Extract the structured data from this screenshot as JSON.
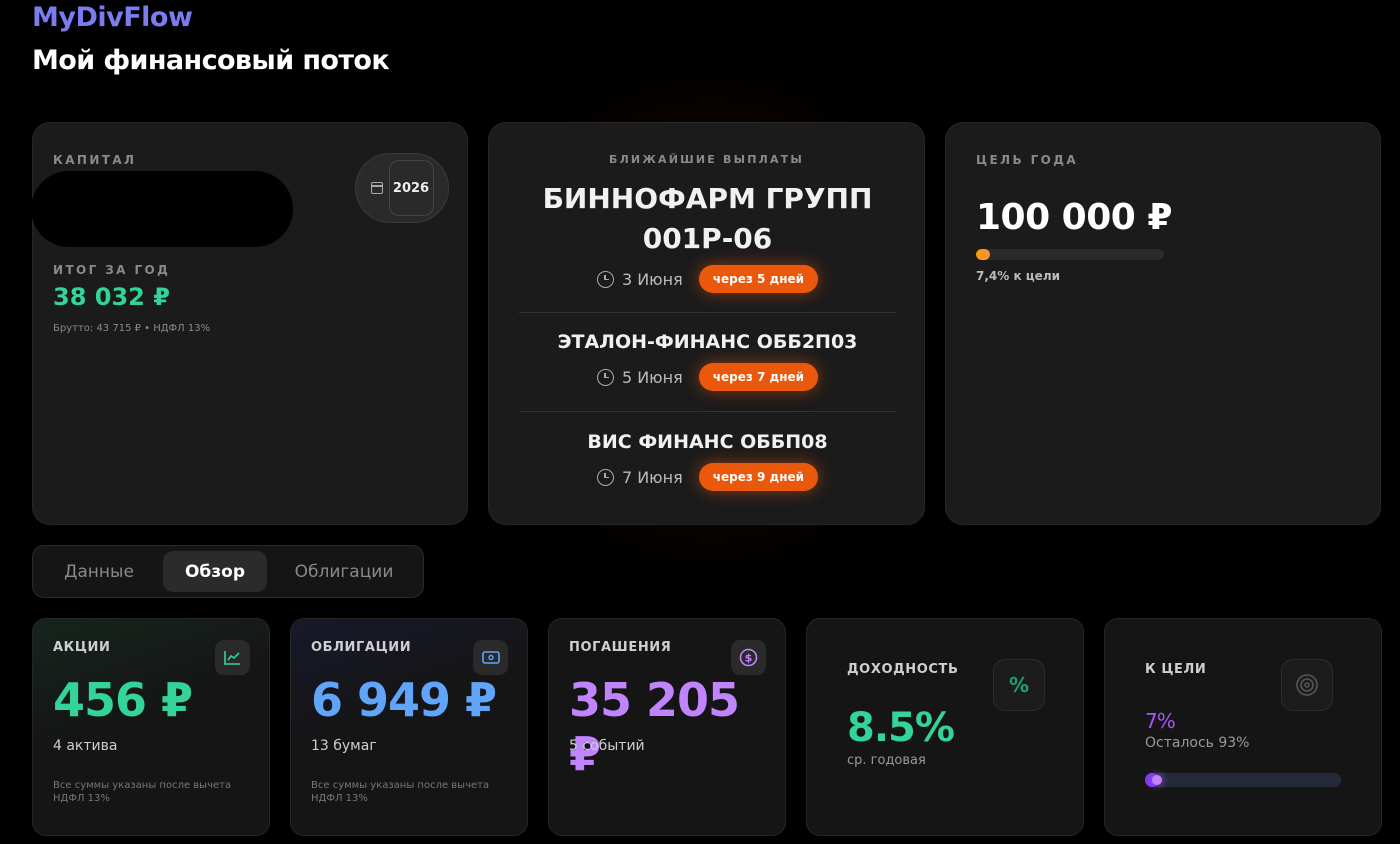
{
  "app_title": "MyDivFlow",
  "page_title": "Мой финансовый поток",
  "capital": {
    "label": "КАПИТАЛ",
    "year": "2026",
    "year_sum_label": "ИТОГ ЗА ГОД",
    "year_sum_value": "38 032 ₽",
    "year_sum_note": "Брутто: 43 715 ₽ • НДФЛ 13%"
  },
  "payouts": {
    "label": "БЛИЖАЙШИЕ ВЫПЛАТЫ",
    "items": [
      {
        "name": "БИННОФАРМ ГРУПП 001Р-06",
        "date": "3 Июня",
        "badge": "через 5 дней"
      },
      {
        "name": "ЭТАЛОН-ФИНАНС ОББ2П03",
        "date": "5 Июня",
        "badge": "через 7 дней"
      },
      {
        "name": "ВИС ФИНАНС ОББП08",
        "date": "7 Июня",
        "badge": "через 9 дней"
      }
    ]
  },
  "goal": {
    "label": "ЦЕЛЬ ГОДА",
    "value": "100 000 ₽",
    "progress_fraction": 0.074,
    "progress_text": "7,4% к цели"
  },
  "tabs": [
    {
      "label": "Данные"
    },
    {
      "label": "Обзор"
    },
    {
      "label": "Облигации"
    }
  ],
  "stats": {
    "stocks": {
      "title": "АКЦИИ",
      "value": "456 ₽",
      "sub": "4 актива",
      "note": "Все суммы указаны после вычета НДФЛ 13%",
      "icon": "chart-icon",
      "color": "#34d399"
    },
    "bonds": {
      "title": "ОБЛИГАЦИИ",
      "value": "6 949 ₽",
      "sub": "13 бумаг",
      "note": "Все суммы указаны после вычета НДФЛ 13%",
      "icon": "cash-icon",
      "color": "#60a5fa"
    },
    "redemptions": {
      "title": "ПОГАШЕНИЯ",
      "value": "35 205 ₽",
      "sub": "5 событий",
      "icon": "dollar-icon",
      "color": "#c084fc"
    },
    "yield": {
      "title": "ДОХОДНОСТЬ",
      "value": "8.5%",
      "sub": "ср. годовая",
      "icon": "percent-icon",
      "color": "#34d399"
    },
    "to_goal": {
      "title": "К ЦЕЛИ",
      "value": "7%",
      "sub": "Осталось 93%",
      "progress_fraction": 0.07,
      "icon": "target-icon",
      "color": "#a855f7"
    }
  }
}
